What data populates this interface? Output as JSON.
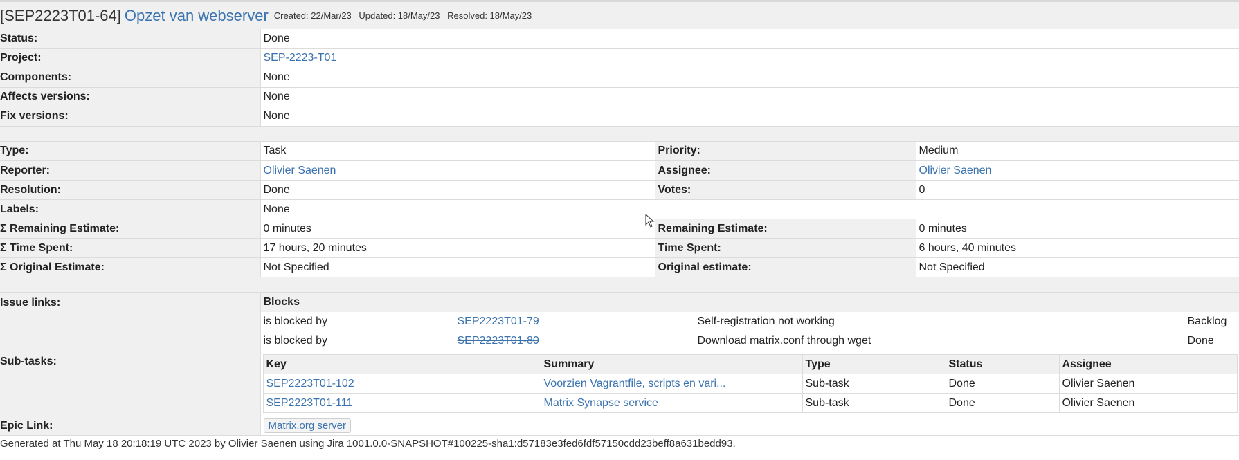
{
  "header": {
    "key": "[SEP2223T01-64]",
    "title": "Opzet van webserver",
    "created": "Created: 22/Mar/23",
    "updated": "Updated: 18/May/23",
    "resolved": "Resolved: 18/May/23"
  },
  "basic": [
    {
      "label": "Status:",
      "value": "Done",
      "link": false
    },
    {
      "label": "Project:",
      "value": "SEP-2223-T01",
      "link": true
    },
    {
      "label": "Components:",
      "value": "None",
      "link": false
    },
    {
      "label": "Affects versions:",
      "value": "None",
      "link": false
    },
    {
      "label": "Fix versions:",
      "value": "None",
      "link": false
    }
  ],
  "details": {
    "type_label": "Type:",
    "type": "Task",
    "priority_label": "Priority:",
    "priority": "Medium",
    "reporter_label": "Reporter:",
    "reporter": "Olivier Saenen",
    "assignee_label": "Assignee:",
    "assignee": "Olivier Saenen",
    "resolution_label": "Resolution:",
    "resolution": "Done",
    "votes_label": "Votes:",
    "votes": "0",
    "labels_label": "Labels:",
    "labels": "None",
    "sum_remaining_label": "Σ Remaining Estimate:",
    "sum_remaining": "0 minutes",
    "remaining_label": "Remaining Estimate:",
    "remaining": "0 minutes",
    "sum_spent_label": "Σ Time Spent:",
    "sum_spent": "17 hours, 20 minutes",
    "spent_label": "Time Spent:",
    "spent": "6 hours, 40 minutes",
    "sum_original_label": "Σ Original Estimate:",
    "sum_original": "Not Specified",
    "original_label": "Original estimate:",
    "original": "Not Specified"
  },
  "issue_links": {
    "label": "Issue links:",
    "group": "Blocks",
    "rows": [
      {
        "relation": "is blocked by",
        "key": "SEP2223T01-79",
        "summary": "Self-registration not working",
        "status": "Backlog",
        "resolved": false
      },
      {
        "relation": "is blocked by",
        "key": "SEP2223T01-80",
        "summary": "Download matrix.conf through wget",
        "status": "Done",
        "resolved": true
      }
    ]
  },
  "subtasks": {
    "label": "Sub-tasks:",
    "columns": [
      "Key",
      "Summary",
      "Type",
      "Status",
      "Assignee"
    ],
    "rows": [
      {
        "key": "SEP2223T01-102",
        "summary": "Voorzien Vagrantfile, scripts en vari...",
        "type": "Sub-task",
        "status": "Done",
        "assignee": "Olivier Saenen"
      },
      {
        "key": "SEP2223T01-111",
        "summary": "Matrix Synapse service",
        "type": "Sub-task",
        "status": "Done",
        "assignee": "Olivier Saenen"
      }
    ]
  },
  "epic": {
    "label": "Epic Link:",
    "value": "Matrix.org server"
  },
  "footer": "Generated at Thu May 18 20:18:19 UTC 2023 by Olivier Saenen using Jira 1001.0.0-SNAPSHOT#100225-sha1:d57183e3fed6fdf57150cdd23beff8a631bedd93."
}
